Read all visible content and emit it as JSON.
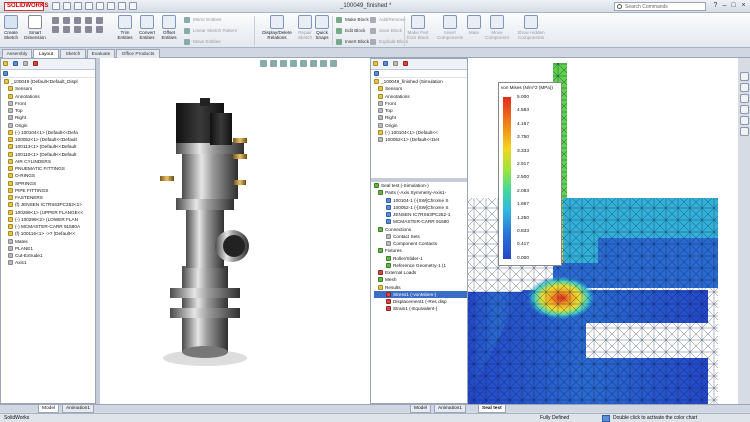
{
  "app": {
    "logo": "SOLIDWORKS",
    "doc_title": "_100049_finished *"
  },
  "search": {
    "placeholder": "Search Commands"
  },
  "ribbon": {
    "sketch": "Create Sketch",
    "smart_dim": "Smart Dimension",
    "trim": "Trim Entities",
    "convert": "Convert Entities",
    "offset": "Offset Entities",
    "mirror": "Mirror Entities",
    "linear_pattern": "Linear Sketch Pattern",
    "move": "Move Entities",
    "display_rel": "Display/Delete Relations",
    "repair": "Repair Sketch",
    "quick_snaps": "Quick Snaps",
    "make_block": "Make Block",
    "edit_block": "Edit Block",
    "insert_block": "Insert Block",
    "add_remove": "Add/Remove",
    "rebuild": "Rebuild",
    "save_block": "Save Block",
    "explode": "Explode Block",
    "make_part": "Make Part from Block",
    "insert_comp": "Insert Components",
    "mate": "Mate",
    "move_comp": "Move Component",
    "show_hidden": "Show Hidden Components"
  },
  "cmd_tabs": [
    "Assembly",
    "Layout",
    "Sketch",
    "Evaluate",
    "Office Products"
  ],
  "left_tree": {
    "root": "_100049 (Default<Default_Displ",
    "items": [
      {
        "label": "Sensors",
        "c": "yellow"
      },
      {
        "label": "Annotations",
        "c": "yellow"
      },
      {
        "label": "Front",
        "c": "gray"
      },
      {
        "label": "Top",
        "c": "gray"
      },
      {
        "label": "Right",
        "c": "gray"
      },
      {
        "label": "Origin",
        "c": "gray"
      },
      {
        "label": "(-) 100104<1> (Default<<Defa",
        "c": "yellow"
      },
      {
        "label": "100052<1> (Default<<Default",
        "c": "yellow"
      },
      {
        "label": "100113<1> (Default<<Default",
        "c": "yellow"
      },
      {
        "label": "100110<1> (Default<<Default",
        "c": "yellow"
      },
      {
        "label": "AIR CYLINDERS",
        "c": "yellow"
      },
      {
        "label": "PNUEMATIC FITTINGS",
        "c": "yellow"
      },
      {
        "label": "O-RINGS",
        "c": "yellow"
      },
      {
        "label": "SPRINGS",
        "c": "yellow"
      },
      {
        "label": "PIPE FITTINGS",
        "c": "yellow"
      },
      {
        "label": "FASTENERS",
        "c": "yellow"
      },
      {
        "label": "(f) JENSEN IC7RS63PC252<1>",
        "c": "yellow"
      },
      {
        "label": "100299<1> (UPPER FLANGE<<",
        "c": "yellow"
      },
      {
        "label": "(-) 100299<2> (LOWER FLAN",
        "c": "yellow"
      },
      {
        "label": "(-) MCMASTER-CARR 91580A",
        "c": "yellow"
      },
      {
        "label": "(f) 100116<1> ->? (Default<<",
        "c": "yellow"
      },
      {
        "label": "Mates",
        "c": "gray"
      },
      {
        "label": "PLANE1",
        "c": "gray"
      },
      {
        "label": "Cut-Extrude1",
        "c": "gray"
      },
      {
        "label": "Axis1",
        "c": "gray"
      }
    ]
  },
  "left_bottom_tabs": [
    "Model",
    "Animation1"
  ],
  "right_top_tree": {
    "root": "_100049_finished (Simulation",
    "items": [
      {
        "label": "Sensors",
        "c": "yellow"
      },
      {
        "label": "Annotations",
        "c": "yellow"
      },
      {
        "label": "Front",
        "c": "gray"
      },
      {
        "label": "Top",
        "c": "gray"
      },
      {
        "label": "Right",
        "c": "gray"
      },
      {
        "label": "Origin",
        "c": "gray"
      },
      {
        "label": "(-) 100104<1> (Default<<",
        "c": "yellow"
      },
      {
        "label": "100052<1> (Default<<Det",
        "c": "gray"
      }
    ]
  },
  "sim_tree": {
    "root": "Seal test (-Simulation-)",
    "items": [
      {
        "label": "Parts (-Axis Symmetry-Axis1-",
        "c": "grn"
      },
      {
        "label": "100104-1 (-[SW]Chrome S",
        "c": "blue"
      },
      {
        "label": "100052-1 (-[SW]Chrome S",
        "c": "blue"
      },
      {
        "label": "JENSEN IC7RS63PC252-1",
        "c": "blue"
      },
      {
        "label": "MCMASTER-CARR 91580",
        "c": "blue"
      },
      {
        "label": "Connections",
        "c": "grn"
      },
      {
        "label": "Contact Sets",
        "c": "gray"
      },
      {
        "label": "Component Contacts",
        "c": "gray"
      },
      {
        "label": "Fixtures",
        "c": "grn"
      },
      {
        "label": "Roller/Slider-1",
        "c": "grn"
      },
      {
        "label": "Reference Geometry-1 (1",
        "c": "grn"
      },
      {
        "label": "External Loads",
        "c": "red"
      },
      {
        "label": "Mesh",
        "c": "grn"
      },
      {
        "label": "Results",
        "c": "yellow"
      },
      {
        "label": "Stress1 (-vonMises-)",
        "c": "red"
      },
      {
        "label": "Displacement1 (-Res disp",
        "c": "red"
      },
      {
        "label": "Strain1 (-Equivalent-)",
        "c": "red"
      }
    ]
  },
  "right_bottom_tabs": [
    "Model",
    "Animation1",
    "Seal test"
  ],
  "legend": {
    "title": "von Mises (N/m^2 (MPa))",
    "ticks": [
      "5.000",
      "4.583",
      "4.167",
      "3.750",
      "3.333",
      "2.917",
      "2.500",
      "2.083",
      "1.667",
      "1.250",
      "0.833",
      "0.417",
      "0.000"
    ]
  },
  "status": {
    "left": "SolidWorks",
    "mid": "Fully Defined",
    "hint": "Double click to activate the color chart"
  },
  "colors": {
    "accent": "#3a6fc5",
    "sim_red": "#e22a1c",
    "sim_blue": "#2447c8"
  }
}
